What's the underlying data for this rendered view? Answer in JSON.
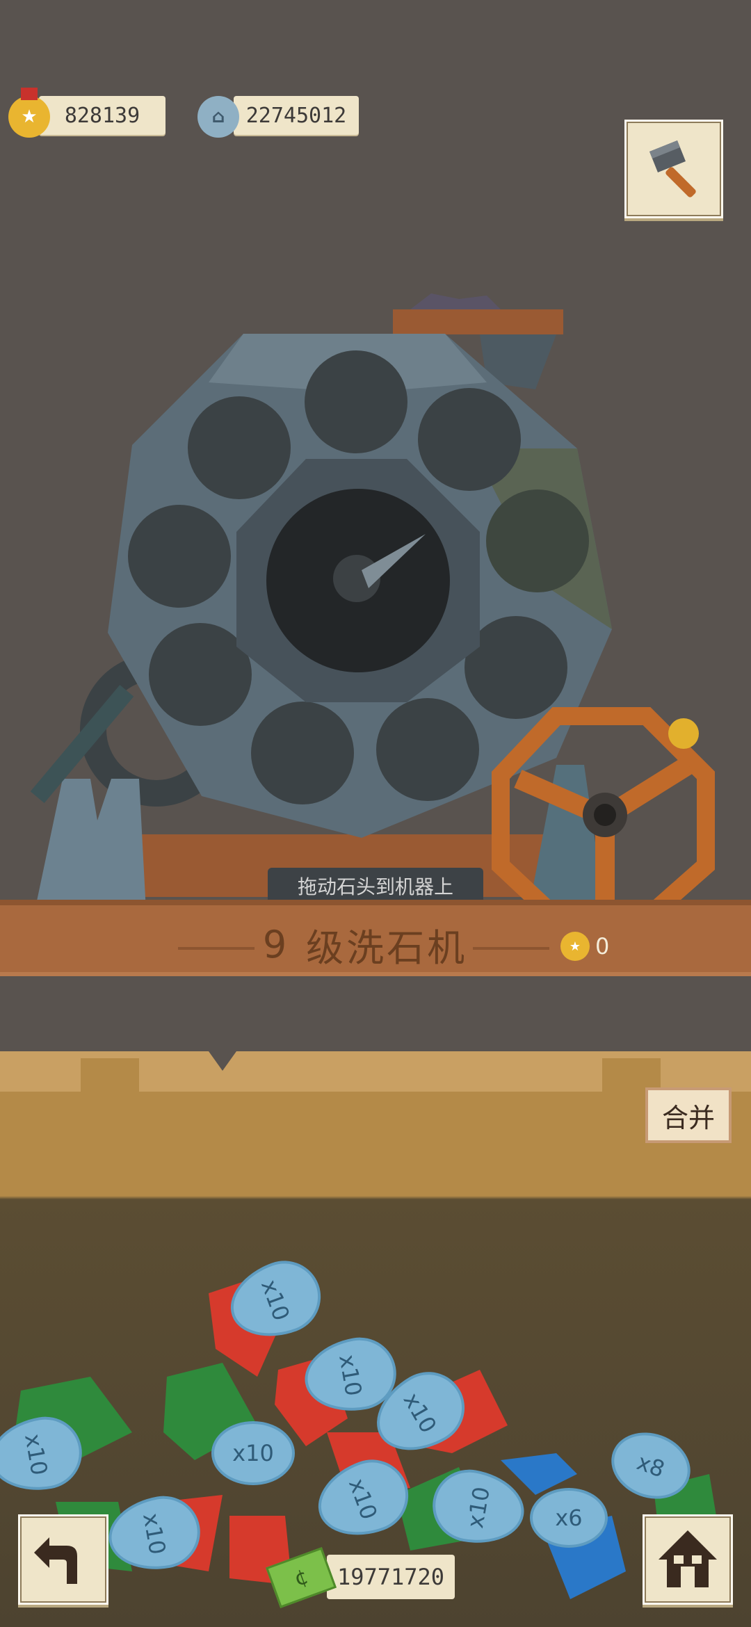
{
  "currencies": {
    "medal": {
      "value": "828139",
      "icon": "medal-icon",
      "color": "#e9b530"
    },
    "gear_coin": {
      "value": "22745012",
      "icon": "gear-coin-icon",
      "color": "#8fb0c4"
    }
  },
  "toolbar": {
    "hammer_icon": "hammer-icon"
  },
  "machine": {
    "hint": "拖动石头到机器上",
    "level": "9",
    "name": "级洗石机",
    "reward": "0"
  },
  "bin": {
    "merge_label": "合并",
    "tags": [
      "x10",
      "x10",
      "x10",
      "x10",
      "x10",
      "x10",
      "x10",
      "x10",
      "x6",
      "x8"
    ]
  },
  "footer": {
    "money": "19771720",
    "back_icon": "back-arrow-icon",
    "home_icon": "home-icon"
  }
}
